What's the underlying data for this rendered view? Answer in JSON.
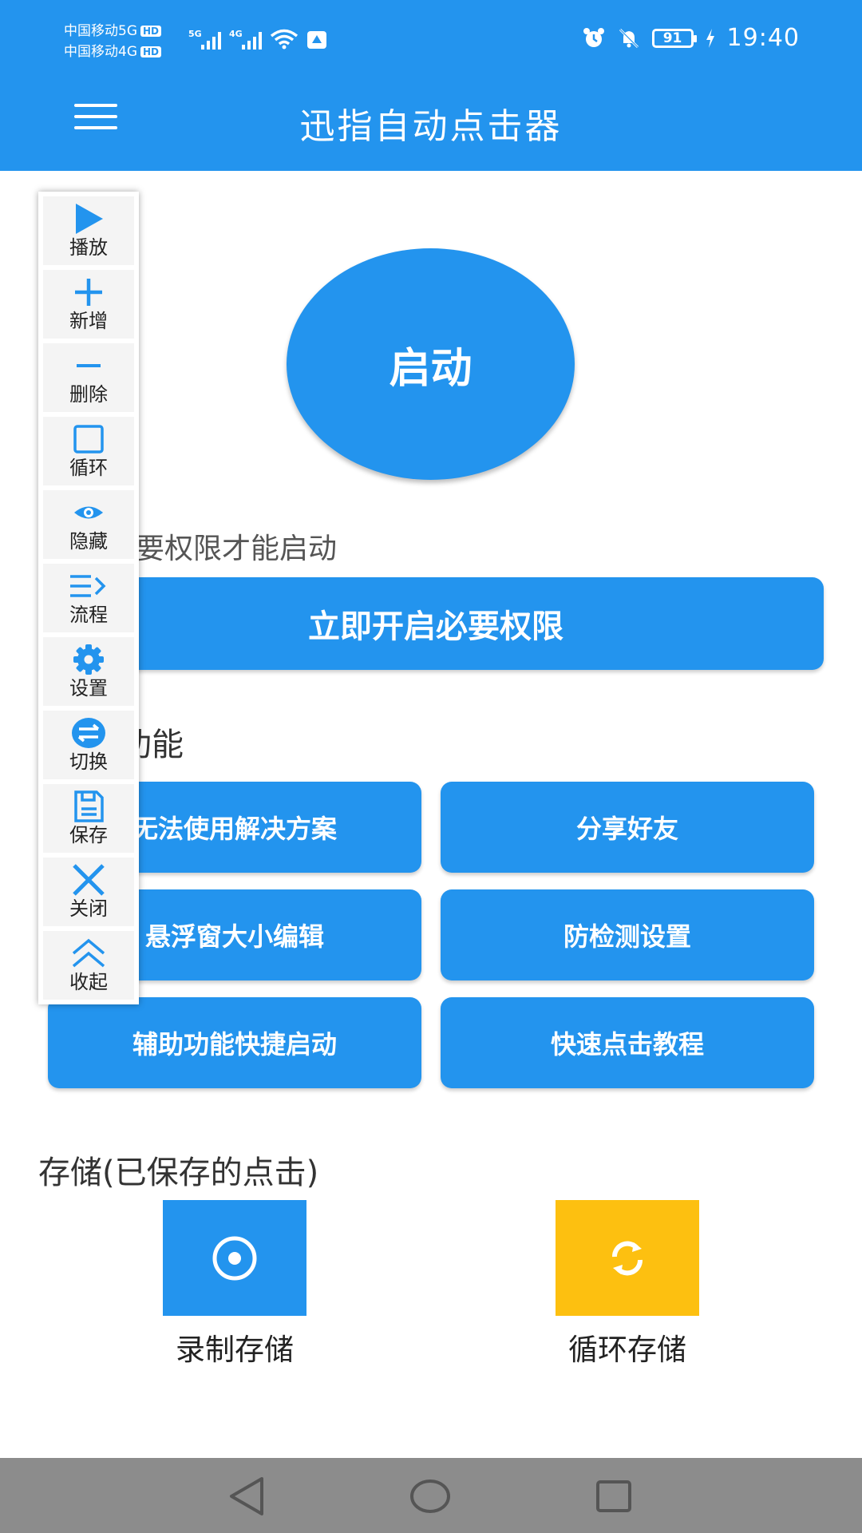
{
  "status_bar": {
    "carrier_1": "中国移动5G",
    "carrier_2": "中国移动4G",
    "hd_badge": "HD",
    "network_1": "5G",
    "network_2": "4G",
    "battery": "91",
    "time": "19:40"
  },
  "header": {
    "title": "迅指自动点击器"
  },
  "main": {
    "start_button": "启动",
    "permission_note": "要权限才能启动",
    "permission_button": "立即开启必要权限",
    "functions_title": "功能",
    "functions": [
      "无法使用解决方案",
      "分享好友",
      "悬浮窗大小编辑",
      "防检测设置",
      "辅助功能快捷启动",
      "快速点击教程"
    ],
    "storage_title": "存储(已保存的点击)",
    "storage": [
      {
        "label": "录制存储",
        "color": "#2394EE",
        "icon": "record-icon"
      },
      {
        "label": "循环存储",
        "color": "#FDC010",
        "icon": "loop-refresh-icon"
      }
    ]
  },
  "floating_toolbar": {
    "items": [
      {
        "label": "播放",
        "icon": "play-icon"
      },
      {
        "label": "新增",
        "icon": "plus-icon"
      },
      {
        "label": "删除",
        "icon": "minus-icon"
      },
      {
        "label": "循环",
        "icon": "square-icon"
      },
      {
        "label": "隐藏",
        "icon": "eye-icon"
      },
      {
        "label": "流程",
        "icon": "list-arrow-icon"
      },
      {
        "label": "设置",
        "icon": "gear-icon"
      },
      {
        "label": "切换",
        "icon": "swap-icon"
      },
      {
        "label": "保存",
        "icon": "save-icon"
      },
      {
        "label": "关闭",
        "icon": "close-icon"
      },
      {
        "label": "收起",
        "icon": "chevron-double-up-icon"
      }
    ]
  },
  "colors": {
    "primary": "#2394EE",
    "loop_tile": "#FDC010",
    "nav_bar": "#8C8C8C"
  }
}
